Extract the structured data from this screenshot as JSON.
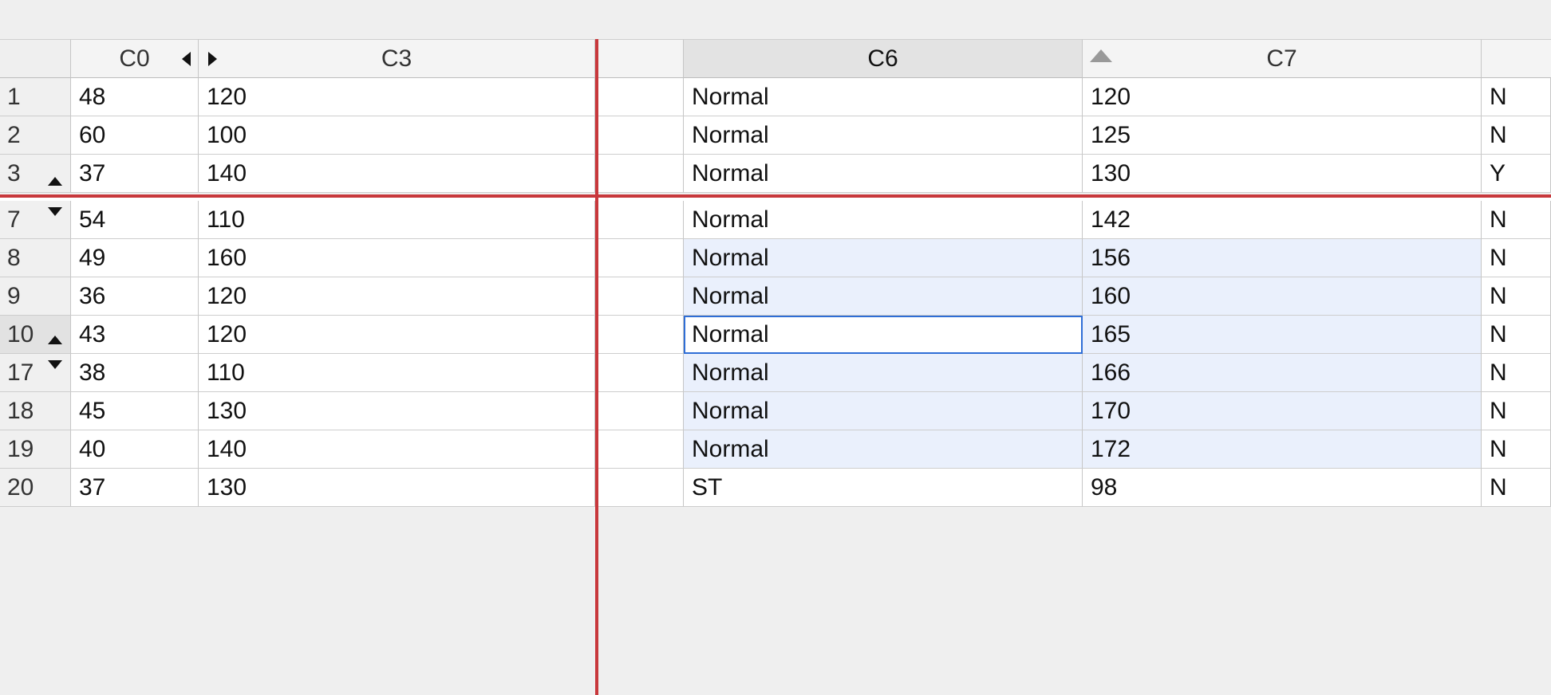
{
  "columns": {
    "c0": "C0",
    "c3": "C3",
    "c6": "C6",
    "c7": "C7"
  },
  "rows": [
    {
      "num": "1",
      "c0": "48",
      "c3": "120",
      "c6": "Normal",
      "c7": "120",
      "c8": "N"
    },
    {
      "num": "2",
      "c0": "60",
      "c3": "100",
      "c6": "Normal",
      "c7": "125",
      "c8": "N"
    },
    {
      "num": "3",
      "c0": "37",
      "c3": "140",
      "c6": "Normal",
      "c7": "130",
      "c8": "Y"
    },
    {
      "num": "7",
      "c0": "54",
      "c3": "110",
      "c6": "Normal",
      "c7": "142",
      "c8": "N"
    },
    {
      "num": "8",
      "c0": "49",
      "c3": "160",
      "c6": "Normal",
      "c7": "156",
      "c8": "N"
    },
    {
      "num": "9",
      "c0": "36",
      "c3": "120",
      "c6": "Normal",
      "c7": "160",
      "c8": "N"
    },
    {
      "num": "10",
      "c0": "43",
      "c3": "120",
      "c6": "Normal",
      "c7": "165",
      "c8": "N"
    },
    {
      "num": "17",
      "c0": "38",
      "c3": "110",
      "c6": "Normal",
      "c7": "166",
      "c8": "N"
    },
    {
      "num": "18",
      "c0": "45",
      "c3": "130",
      "c6": "Normal",
      "c7": "170",
      "c8": "N"
    },
    {
      "num": "19",
      "c0": "40",
      "c3": "140",
      "c6": "Normal",
      "c7": "172",
      "c8": "N"
    },
    {
      "num": "20",
      "c0": "37",
      "c3": "130",
      "c6": "ST",
      "c7": "98",
      "c8": "N"
    }
  ],
  "selection": {
    "active_row": "10",
    "active_column": "C6",
    "highlighted_rows": [
      "8",
      "9",
      "10",
      "17",
      "18",
      "19"
    ],
    "highlight_color": "#eaf0fc",
    "active_border_color": "#2f6ed6"
  },
  "sort": {
    "column": "C7",
    "direction": "ascending",
    "icon": "sort-ascending-icon"
  },
  "freeze_line_color": "#c8383c",
  "icons": {
    "hidden_rows_up": "expand-up-icon",
    "hidden_rows_down": "expand-down-icon",
    "hidden_columns_left": "triangle-left-icon",
    "hidden_columns_right": "triangle-right-icon"
  }
}
